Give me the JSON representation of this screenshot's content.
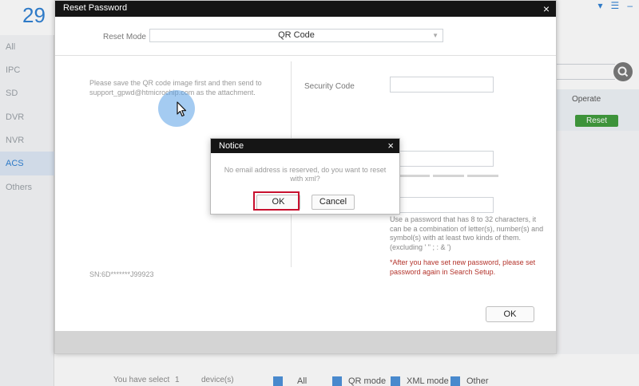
{
  "background_app": {
    "device_count": "29",
    "sidebar": [
      {
        "label": "All",
        "active": false
      },
      {
        "label": "IPC",
        "active": false
      },
      {
        "label": "SD",
        "active": false
      },
      {
        "label": "DVR",
        "active": false
      },
      {
        "label": "NVR",
        "active": false
      },
      {
        "label": "ACS",
        "active": true
      },
      {
        "label": "Others",
        "active": false
      }
    ],
    "table": {
      "operate_label": "Operate",
      "reset_button": "Reset"
    },
    "footer": {
      "select_text": "You have select",
      "select_count": "1",
      "select_unit": "device(s)",
      "filters": [
        "All",
        "QR mode",
        "XML mode",
        "Other"
      ]
    }
  },
  "reset_dialog": {
    "title": "Reset Password",
    "mode_label": "Reset Mode",
    "mode_value": "QR Code",
    "instructions": "Please save the QR code image first and then send to support_gpwd@htmicrochip.com as the attachment.",
    "sn": "SN:6D*******J99923",
    "security_code_label": "Security Code",
    "password_hint": "Use a password that has 8 to 32 characters, it can be a combination of letter(s), number(s) and symbol(s) with at least two kinds of them.(excluding ' \" ; : & ')",
    "password_warning": "*After you have set new password, please set password again in Search Setup.",
    "ok_button": "OK"
  },
  "notice_dialog": {
    "title": "Notice",
    "message": "No email address is reserved, do you want to reset with xml?",
    "ok_button": "OK",
    "cancel_button": "Cancel",
    "highlight_color": "#c8102e"
  },
  "colors": {
    "titlebar": "#151515",
    "accent_blue": "#2d7fd3",
    "reset_green": "#3d9b3a",
    "warning_red": "#b3332b"
  }
}
